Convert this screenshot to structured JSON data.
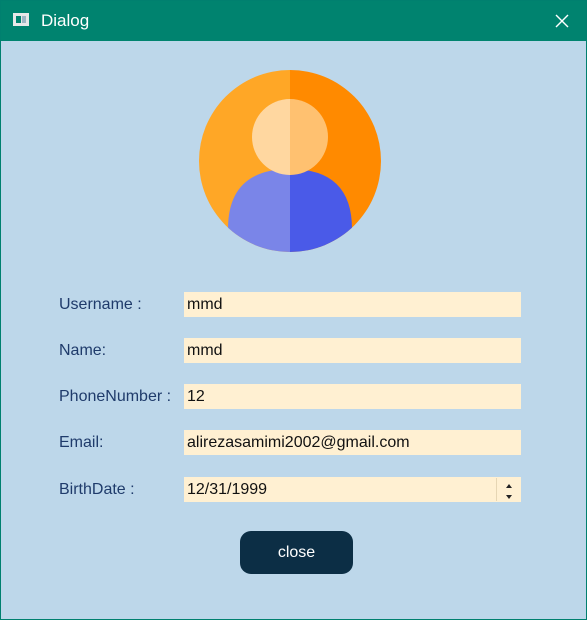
{
  "window": {
    "title": "Dialog",
    "app_icon": "window-app-icon",
    "close_icon": "close-icon"
  },
  "avatar": {
    "icon": "user-avatar-icon",
    "colors": {
      "circle_left": "#ffa726",
      "circle_right": "#ff8a00",
      "head_left": "#ffd7a0",
      "head_right": "#ffc170",
      "body_left": "#7a85e8",
      "body_right": "#4a5ae8"
    }
  },
  "form": {
    "username": {
      "label": "Username :",
      "value": "mmd"
    },
    "name": {
      "label": "Name:",
      "value": "mmd"
    },
    "phone": {
      "label": "PhoneNumber :",
      "value": "12"
    },
    "email": {
      "label": "Email:",
      "value": "alirezasamimi2002@gmail.com"
    },
    "birthdate": {
      "label": "BirthDate :",
      "value": "12/31/1999"
    }
  },
  "actions": {
    "close_label": "close"
  },
  "colors": {
    "titlebar": "#00836f",
    "background": "#bdd7ea",
    "field": "#fff0d2",
    "label": "#1f3b6b",
    "button": "#0c2e45"
  }
}
